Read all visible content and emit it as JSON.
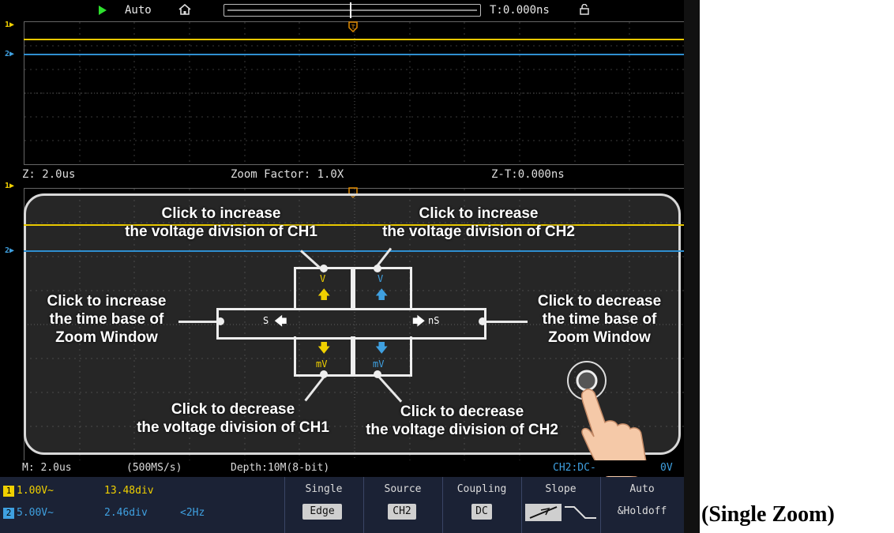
{
  "topbar": {
    "run_state": "Auto",
    "trigger_time": "T:0.000ns",
    "icons": [
      "run-icon",
      "home-icon",
      "lock-icon"
    ]
  },
  "zoom_info": {
    "zoom_timebase": "Z: 2.0us",
    "zoom_factor": "Zoom Factor: 1.0X",
    "zoom_trigger_time": "Z-T:0.000ns"
  },
  "annotations": {
    "ch1_increase": [
      "Click to increase",
      "the voltage division of CH1"
    ],
    "ch2_increase": [
      "Click to increase",
      "the voltage division of CH2"
    ],
    "timebase_increase": [
      "Click to increase",
      "the time base of",
      "Zoom Window"
    ],
    "timebase_decrease": [
      "Click to decrease",
      "the time base of",
      "Zoom Window"
    ],
    "ch1_decrease": [
      "Click to decrease",
      "the voltage division of CH1"
    ],
    "ch2_decrease": [
      "Click to decrease",
      "the voltage division of CH2"
    ],
    "arrows": {
      "v": "V",
      "mv": "mV",
      "s": "S",
      "ns": "nS"
    }
  },
  "status": {
    "main_timebase": "M: 2.0us",
    "sample_rate": "(500MS/s)",
    "depth": "Depth:10M(8-bit)",
    "trigger_info": "CH2:DC-",
    "trigger_level_suffix": "0V"
  },
  "channels": [
    {
      "badge": "1",
      "scale": "1.00V~",
      "position": "13.48div",
      "extra": "",
      "color": "#f0d000"
    },
    {
      "badge": "2",
      "scale": "5.00V~",
      "position": "2.46div",
      "extra": "<2Hz",
      "color": "#3fa0e0"
    }
  ],
  "menu": [
    {
      "top": "Single",
      "bottom": "Edge"
    },
    {
      "top": "Source",
      "bottom": "CH2"
    },
    {
      "top": "Coupling",
      "bottom": "DC"
    },
    {
      "top": "Slope",
      "bottom": ""
    },
    {
      "top": "Auto",
      "bottom": "&Holdoff"
    }
  ],
  "caption": "(Single Zoom)",
  "colors": {
    "ch1": "#f0d000",
    "ch2": "#3fa0e0",
    "trigger": "#e08a00",
    "menu_bg": "#1b2235"
  }
}
